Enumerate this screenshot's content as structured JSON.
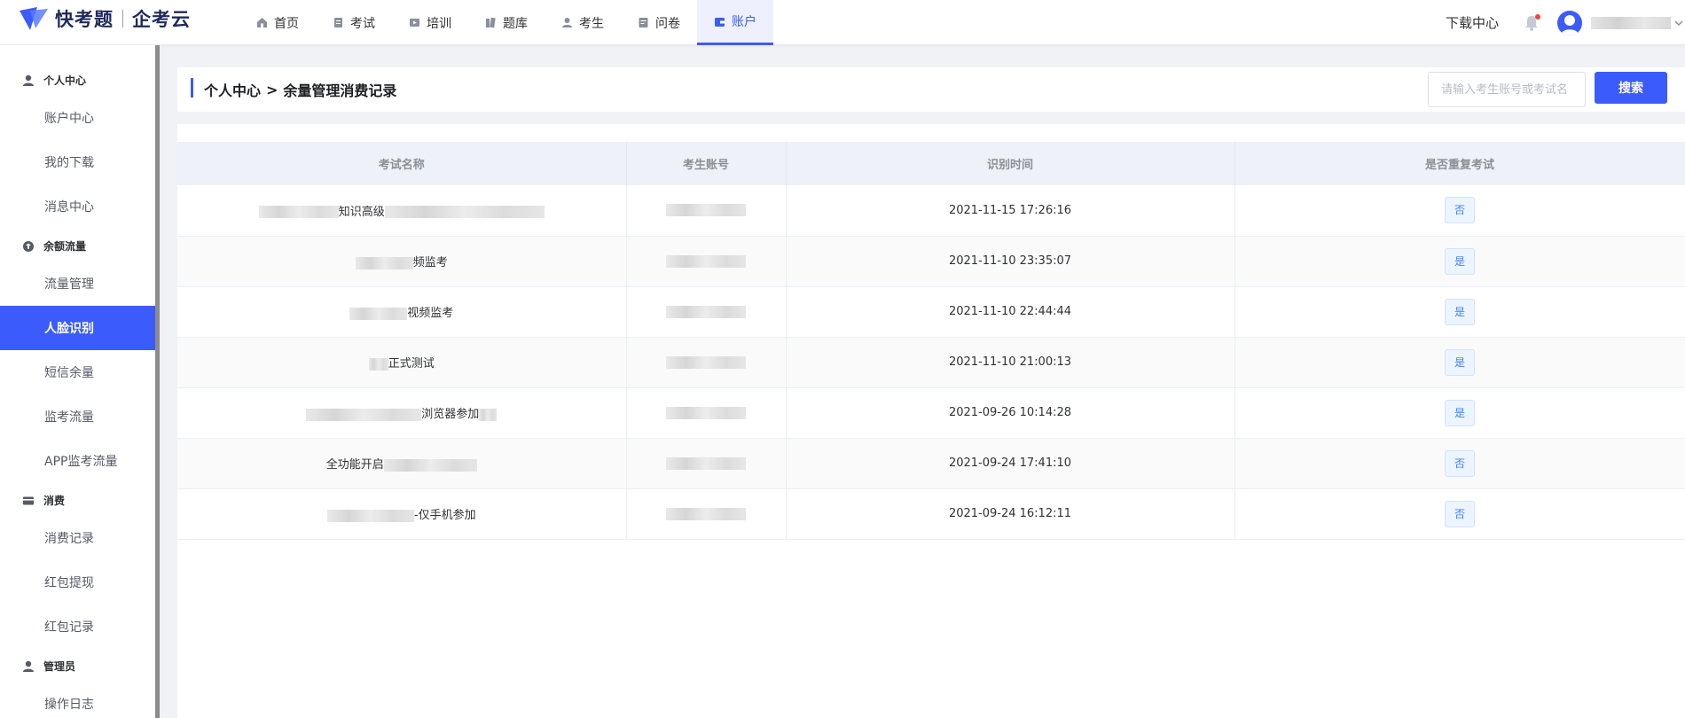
{
  "brand": {
    "name": "快考题",
    "partner": "企考云"
  },
  "nav": [
    {
      "label": "首页",
      "icon": "home-icon"
    },
    {
      "label": "考试",
      "icon": "exam-icon"
    },
    {
      "label": "培训",
      "icon": "training-icon"
    },
    {
      "label": "题库",
      "icon": "question-bank-icon"
    },
    {
      "label": "考生",
      "icon": "candidate-icon"
    },
    {
      "label": "问卷",
      "icon": "survey-icon"
    },
    {
      "label": "账户",
      "icon": "account-icon",
      "active": true
    }
  ],
  "header": {
    "download_center": "下载中心"
  },
  "sidebar": {
    "groups": [
      {
        "title": "个人中心",
        "icon": "user-icon",
        "items": [
          "账户中心",
          "我的下载",
          "消息中心"
        ]
      },
      {
        "title": "余额流量",
        "icon": "balance-icon",
        "items": [
          "流量管理",
          "人脸识别",
          "短信余量",
          "监考流量",
          "APP监考流量"
        ]
      },
      {
        "title": "消费",
        "icon": "card-icon",
        "items": [
          "消费记录",
          "红包提现",
          "红包记录"
        ]
      },
      {
        "title": "管理员",
        "icon": "admin-icon",
        "items": [
          "操作日志"
        ]
      }
    ],
    "active_item": "人脸识别"
  },
  "page": {
    "breadcrumb_root": "个人中心",
    "breadcrumb_sep": ">",
    "breadcrumb_current": "余量管理消费记录",
    "search_placeholder": "请输入考生账号或考试名",
    "search_button": "搜索"
  },
  "table": {
    "columns": [
      "考试名称",
      "考生账号",
      "识别时间",
      "是否重复考试"
    ],
    "rows": [
      {
        "exam_name": "知识高级",
        "time": "2021-11-15 17:26:16",
        "repeat": "否"
      },
      {
        "exam_name": "频监考",
        "time": "2021-11-10 23:35:07",
        "repeat": "是"
      },
      {
        "exam_name": "视频监考",
        "time": "2021-11-10 22:44:44",
        "repeat": "是"
      },
      {
        "exam_name": "正式测试",
        "time": "2021-11-10 21:00:13",
        "repeat": "是"
      },
      {
        "exam_name": "浏览器参加",
        "time": "2021-09-26 10:14:28",
        "repeat": "是"
      },
      {
        "exam_name": "全功能开启",
        "time": "2021-09-24 17:41:10",
        "repeat": "否"
      },
      {
        "exam_name": "-仅手机参加",
        "time": "2021-09-24 16:12:11",
        "repeat": "否"
      }
    ]
  },
  "colors": {
    "accent": "#3b5bfd",
    "badge_text": "#3b82f6",
    "badge_bg": "#ecf5ff",
    "notification_dot": "#f04438"
  }
}
